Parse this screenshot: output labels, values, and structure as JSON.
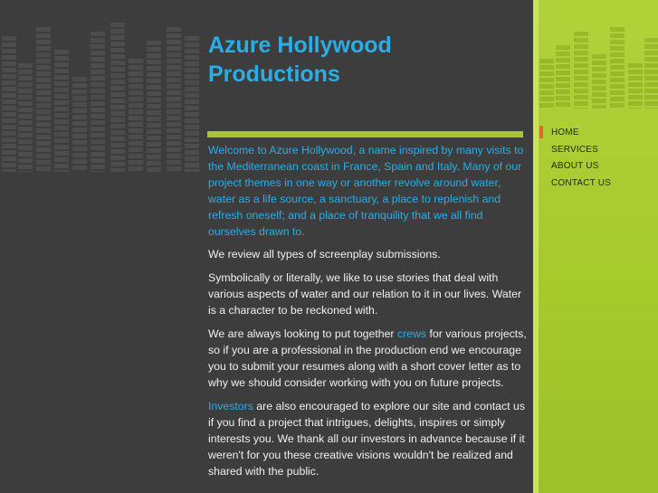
{
  "site": {
    "title": "Azure Hollywood Productions"
  },
  "nav": {
    "items": [
      {
        "label": "HOME",
        "active": true
      },
      {
        "label": "SERVICES",
        "active": false
      },
      {
        "label": "ABOUT US",
        "active": false
      },
      {
        "label": "CONTACT US",
        "active": false
      }
    ]
  },
  "content": {
    "intro": "Welcome to Azure Hollywood, a name inspired by many visits to the Mediterranean coast in France, Spain and Italy. Many of our project themes in one way or another revolve around water, water as a life source, a sanctuary, a place to replenish and refresh oneself; and a place of tranquility that we all find ourselves drawn to.",
    "p1": "We review all types of screenplay submissions.",
    "p2": "Symbolically or literally, we like to use stories that deal with various aspects of water and our relation to it in our lives. Water is a character to be reckoned with.",
    "p3_before": "We are always looking to put together ",
    "p3_link": "crews",
    "p3_after": "  for various projects, so if you are a professional in the production end we encourage you to submit your resumes along with a short cover letter as to why we should consider working with you on future projects.",
    "p4_link": "Investors",
    "p4_after": " are also encouraged to explore our site and contact us if you find a project that intrigues, delights, inspires or simply interests you. We thank all our investors in advance because if it weren't for you these creative visions wouldn't be realized and shared with the public."
  },
  "colors": {
    "accent_blue": "#29aee6",
    "accent_green": "#a8c62e",
    "active_marker": "#e06a2c",
    "background": "#3d3d3d"
  }
}
